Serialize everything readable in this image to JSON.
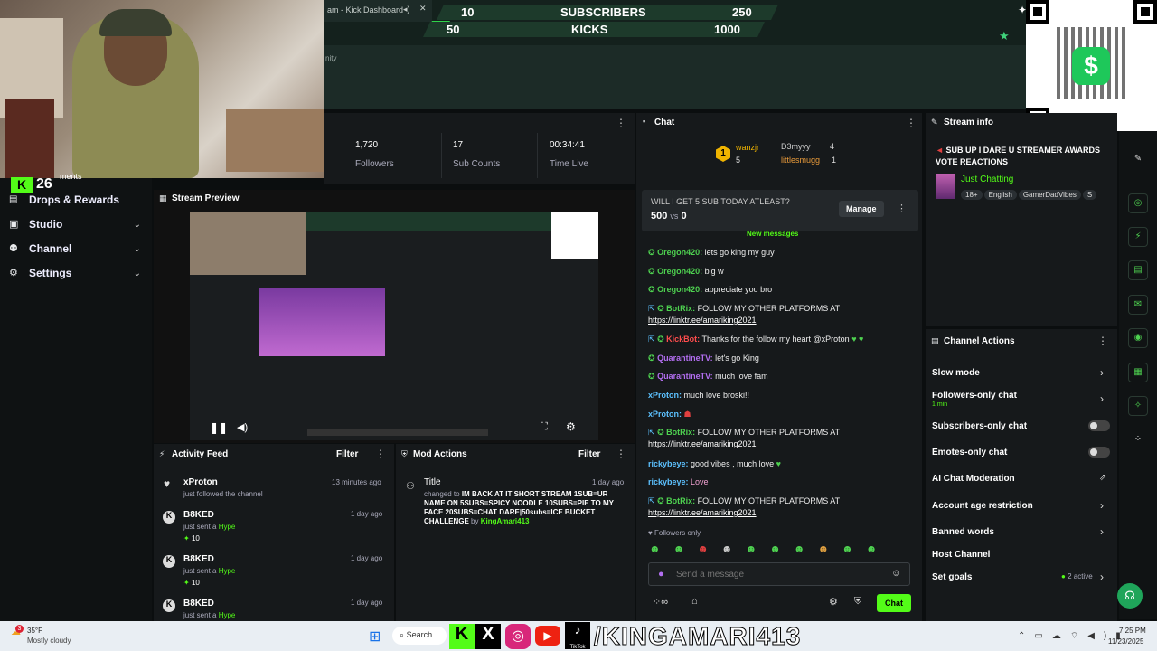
{
  "browser_tab": {
    "title": "am - Kick Dashboard"
  },
  "overlay": {
    "row1": {
      "left": "10",
      "label": "SUBSCRIBERS",
      "right": "250"
    },
    "row2": {
      "left": "50",
      "label": "KICKS",
      "right": "1000"
    },
    "community": "nity"
  },
  "sidebar": {
    "badge_num": "26",
    "partial_label": "ments",
    "items": [
      {
        "label": "Drops & Rewards"
      },
      {
        "label": "Studio"
      },
      {
        "label": "Channel"
      },
      {
        "label": "Settings"
      }
    ]
  },
  "stats": {
    "followers": {
      "value": "1,720",
      "label": "Followers"
    },
    "subs": {
      "value": "17",
      "label": "Sub Counts"
    },
    "time": {
      "value": "00:34:41",
      "label": "Time Live"
    }
  },
  "preview": {
    "title": "Stream Preview"
  },
  "chat": {
    "title": "Chat",
    "leaders": [
      {
        "rank": "1",
        "name": "wanzjr",
        "count": "5"
      },
      {
        "name": "D3myyy",
        "count": "4"
      },
      {
        "name": "littlesmugg",
        "count": "1"
      }
    ],
    "poll": {
      "question": "WILL I GET 5 SUB TODAY ATLEAST?",
      "score": "500",
      "vs": "vs",
      "score2": "0",
      "manage": "Manage"
    },
    "new_messages": "New messages",
    "messages": [
      {
        "user": "Oregon420:",
        "text": " lets go king my guy"
      },
      {
        "user": "Oregon420:",
        "text": " big w"
      },
      {
        "user": "Oregon420:",
        "text": " appreciate you bro"
      },
      {
        "user": "BotRix:",
        "text": " FOLLOW MY OTHER PLATFORMS AT",
        "link": "https://linktr.ee/amariking2021"
      },
      {
        "user": "KickBot:",
        "text": " Thanks for the follow my heart @xProton"
      },
      {
        "user": "QuarantineTV:",
        "text": " let's go King"
      },
      {
        "user": "QuarantineTV:",
        "text": " much love fam"
      },
      {
        "user": "xProton:",
        "text": " much love broski!!"
      },
      {
        "user": "xProton:",
        "text": ""
      },
      {
        "user": "BotRix:",
        "text": " FOLLOW MY OTHER PLATFORMS AT",
        "link": "https://linktr.ee/amariking2021"
      },
      {
        "user": "rickybeye:",
        "text": " good vibes , much love"
      },
      {
        "user": "rickybeye:",
        "text": " Love"
      },
      {
        "user": "BotRix:",
        "text": " FOLLOW MY OTHER PLATFORMS AT",
        "link": "https://linktr.ee/amariking2021"
      }
    ],
    "followers_only": "Followers only",
    "input_placeholder": "Send a message",
    "send_label": "Chat"
  },
  "stream_info": {
    "title": "Stream info",
    "stream_title": "SUB UP I DARE U STREAMER AWARDS VOTE REACTIONS",
    "category": "Just Chatting",
    "tags": [
      "18+",
      "English",
      "GamerDadVibes",
      "S"
    ]
  },
  "channel_actions": {
    "title": "Channel Actions",
    "items": [
      {
        "label": "Slow mode"
      },
      {
        "label": "Followers-only chat",
        "sub": "1 min"
      },
      {
        "label": "Subscribers-only chat"
      },
      {
        "label": "Emotes-only chat"
      },
      {
        "label": "AI Chat Moderation"
      },
      {
        "label": "Account age restriction"
      },
      {
        "label": "Banned words"
      },
      {
        "label": "Host Channel"
      },
      {
        "label": "Set goals",
        "sub": "2 active"
      }
    ]
  },
  "activity_feed": {
    "title": "Activity Feed",
    "filter": "Filter",
    "items": [
      {
        "name": "xProton",
        "sub": "just followed the channel",
        "time": "13 minutes ago"
      },
      {
        "name": "B8KED",
        "sub": "just sent a",
        "hype": "Hype",
        "amount": "10",
        "time": "1 day ago"
      },
      {
        "name": "B8KED",
        "sub": "just sent a",
        "hype": "Hype",
        "amount": "10",
        "time": "1 day ago"
      },
      {
        "name": "B8KED",
        "sub": "just sent a",
        "hype": "Hype",
        "time": "1 day ago"
      }
    ]
  },
  "mod_actions": {
    "title": "Mod Actions",
    "filter": "Filter",
    "item": {
      "title": "Title",
      "time": "1 day ago",
      "changed_to": "changed to",
      "text": "IM BACK AT IT SHORT STREAM 1SUB=UR NAME ON 5SUBS=SPICY NOODLE 10SUBS=PIE TO MY FACE 20SUBS=CHAT DARE|50subs=ICE BUCKET CHALLENGE",
      "by": "by",
      "user": "KingAmari413"
    }
  },
  "taskbar": {
    "weather_temp": "35°F",
    "weather_desc": "Mostly cloudy",
    "badge": "3",
    "search": "Search",
    "overlay_text": "/KINGAMARI413",
    "tiktok_label": "TikTok",
    "time": "7:25 PM",
    "date": "11/23/2025"
  },
  "colors": {
    "kick_green": "#53fc18",
    "panel": "#16191b",
    "bg": "#0b0e0f"
  }
}
